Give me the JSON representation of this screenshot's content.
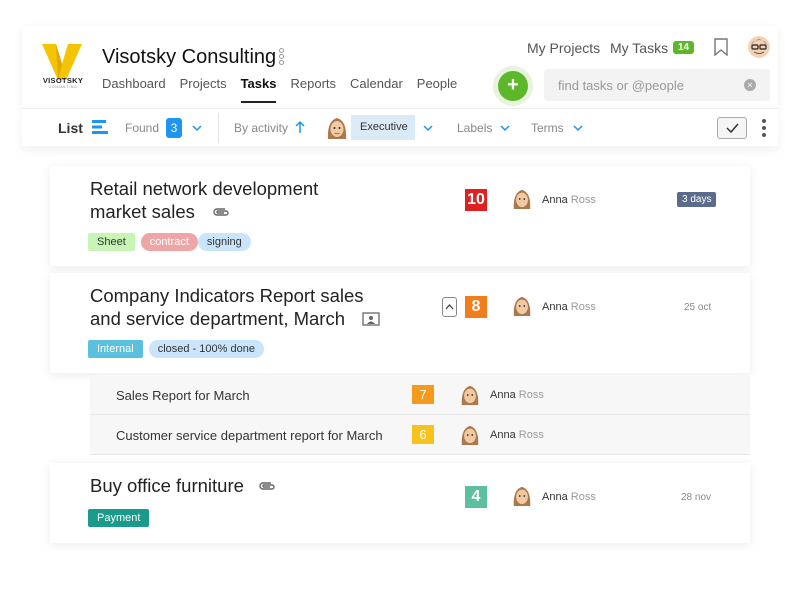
{
  "header": {
    "logo_text": "VISOTSKY",
    "logo_sub": "CONSULTING",
    "company": "Visotsky Consulting",
    "nav": [
      "Dashboard",
      "Projects",
      "Tasks",
      "Reports",
      "Calendar",
      "People"
    ],
    "nav_active": "Tasks",
    "my_projects": "My Projects",
    "my_tasks": "My Tasks",
    "my_tasks_count": "14",
    "add_label": "+",
    "search_placeholder": "find tasks or @people",
    "search_clear": "×"
  },
  "toolbar": {
    "view": "List",
    "found_label": "Found",
    "found_count": "3",
    "sort": "By activity",
    "role": "Executive",
    "labels": "Labels",
    "terms": "Terms"
  },
  "tasks": [
    {
      "title_line1": "Retail network development",
      "title_line2": "market sales",
      "tags": [
        "Sheet",
        "contract",
        "signing"
      ],
      "priority": "10",
      "priority_color": "#e02020",
      "assignee_first": "Anna",
      "assignee_last": "Ross",
      "due": "3 days"
    },
    {
      "title_line1": "Company Indicators Report sales",
      "title_line2": "and service department, March",
      "tags": [
        "Internal",
        "closed - 100% done"
      ],
      "priority": "8",
      "priority_color": "#f27e1b",
      "assignee_first": "Anna",
      "assignee_last": "Ross",
      "due": "25 oct",
      "subtasks": [
        {
          "title": "Sales Report for March",
          "priority": "7",
          "priority_color": "#f59a1b",
          "assignee_first": "Anna",
          "assignee_last": "Ross"
        },
        {
          "title": "Customer service department report for March",
          "priority": "6",
          "priority_color": "#f7c21b",
          "assignee_first": "Anna",
          "assignee_last": "Ross"
        }
      ]
    },
    {
      "title_line1": "Buy office furniture",
      "tags": [
        "Payment"
      ],
      "priority": "4",
      "priority_color": "#5cbf9f",
      "assignee_first": "Anna",
      "assignee_last": "Ross",
      "due": "28 nov"
    }
  ],
  "colors": {
    "accent_green": "#5cb82a",
    "accent_blue": "#1e96f0",
    "logo_yellow": "#f5c400"
  },
  "icons": [
    "logo-v-icon",
    "kebab-icon",
    "bookmark-icon",
    "plus-icon",
    "clear-icon",
    "list-view-icon",
    "chevron-down-icon",
    "arrow-up-icon",
    "check-icon",
    "more-icon",
    "paperclip-icon",
    "contact-card-icon",
    "collapse-icon"
  ]
}
